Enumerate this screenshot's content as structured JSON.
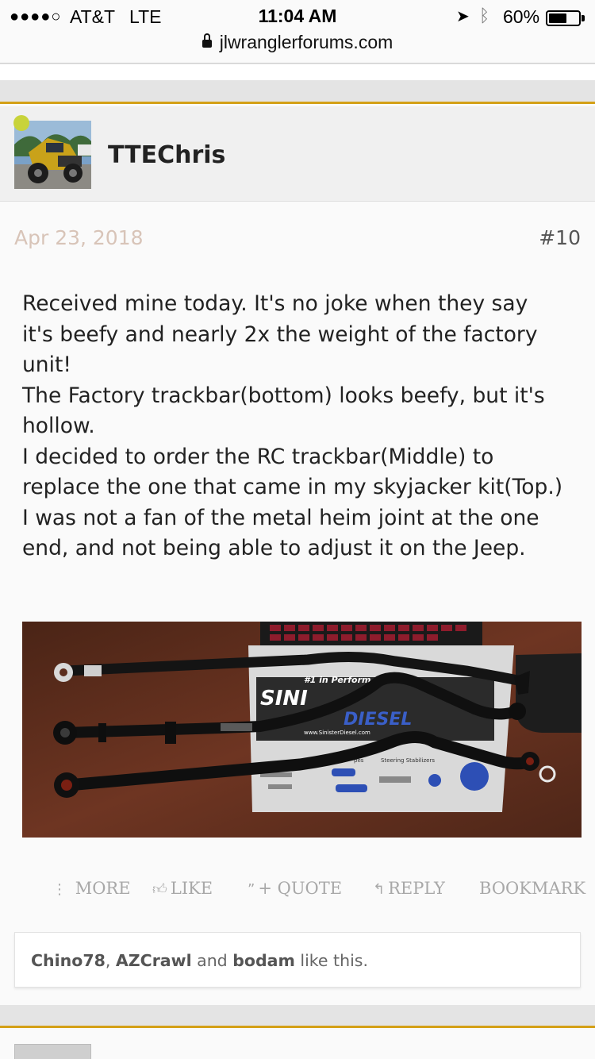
{
  "status_bar": {
    "signal": "●●●●○",
    "carrier": "AT&T",
    "network": "LTE",
    "time": "11:04 AM",
    "battery_pct": "60%",
    "battery_level": 0.6
  },
  "browser": {
    "url": "jlwranglerforums.com"
  },
  "post": {
    "username": "TTEChris",
    "date": "Apr 23, 2018",
    "number": "#10",
    "body_lines": [
      "Received mine today. It's no joke when they say",
      "it's beefy and nearly 2x the weight of the factory",
      "unit!",
      "The Factory trackbar(bottom) looks beefy, but it's",
      "hollow.",
      "I decided to order the RC trackbar(Middle) to",
      "replace the one that came in my skyjacker kit(Top.)",
      "I was not a fan of the metal heim joint at the one",
      "end, and not being able to adjust it on the Jeep."
    ],
    "image_text": {
      "banner": "#1 in Perform",
      "brand_top": "SINI",
      "brand_bottom": "DIESEL",
      "site": "www.SinisterDiesel.com",
      "steering": "Steering Stabilizers",
      "pipes": "pes"
    },
    "actions": {
      "more": "MORE",
      "like": "LIKE",
      "quote": "+ QUOTE",
      "reply": "REPLY",
      "bookmark": "BOOKMARK"
    },
    "likes": {
      "users": [
        "Chino78",
        "AZCrawl",
        "bodam"
      ],
      "sep1": ", ",
      "sep2": " and ",
      "suffix": " like this."
    }
  },
  "icons": {
    "more": "vertical-dots-icon",
    "like": "thumbs-up-icon",
    "quote": "quote-icon",
    "reply": "reply-arrow-icon",
    "lock": "lock-icon",
    "location": "location-arrow-icon",
    "bluetooth": "bluetooth-icon"
  },
  "colors": {
    "accent": "#d4a017",
    "date": "#d8c4b8",
    "action_text": "#a8a8a8",
    "online": "#c8d33a"
  }
}
